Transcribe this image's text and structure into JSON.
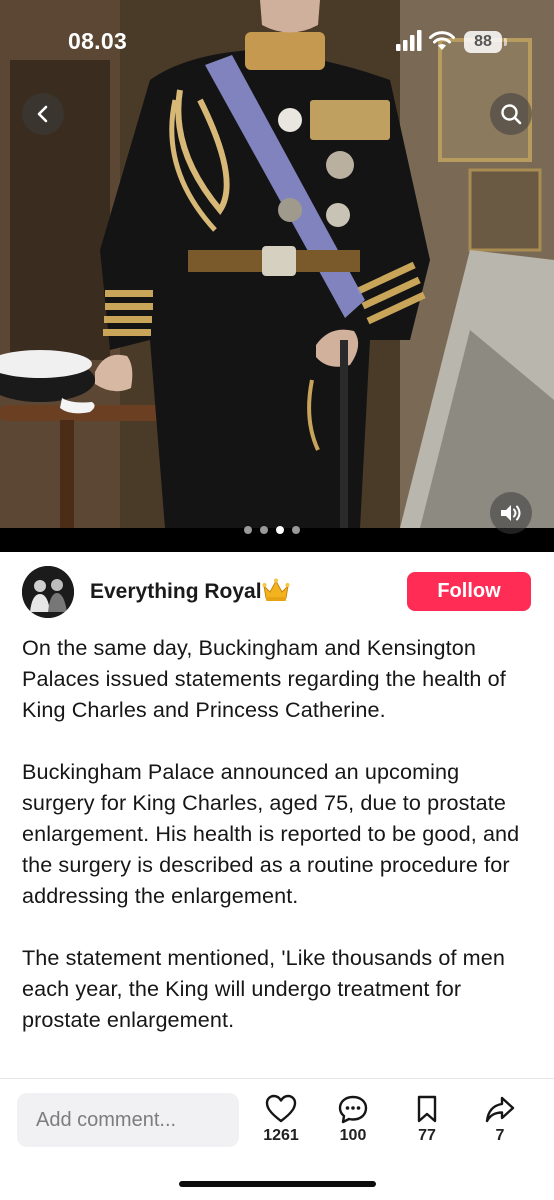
{
  "status_bar": {
    "time": "08.03",
    "battery": "88"
  },
  "carousel": {
    "slide_count": 4,
    "active_slide": 3
  },
  "author": {
    "name": "Everything Royal",
    "badge_emoji": "crown",
    "follow_label": "Follow"
  },
  "caption": {
    "paragraphs": [
      "On the same day, Buckingham and Kensington Palaces issued statements regarding the health of King Charles and Princess Catherine.",
      "Buckingham Palace announced an upcoming surgery for King Charles, aged 75, due to prostate enlargement. His health is reported to be good, and the surgery is described as a routine procedure for addressing the enlargement.",
      "The statement mentioned, 'Like thousands of men each year, the King will undergo treatment for prostate enlargement."
    ]
  },
  "bottom_bar": {
    "comment_placeholder": "Add comment...",
    "likes": "1261",
    "comments": "100",
    "saves": "77",
    "shares": "7"
  },
  "icons": [
    "back-arrow-icon",
    "search-icon",
    "sound-icon",
    "heart-icon",
    "comment-icon",
    "bookmark-icon",
    "share-icon",
    "crown-icon"
  ],
  "colors": {
    "accent": "#ff2c55",
    "text": "#161616",
    "muted": "#7d7d7d"
  }
}
